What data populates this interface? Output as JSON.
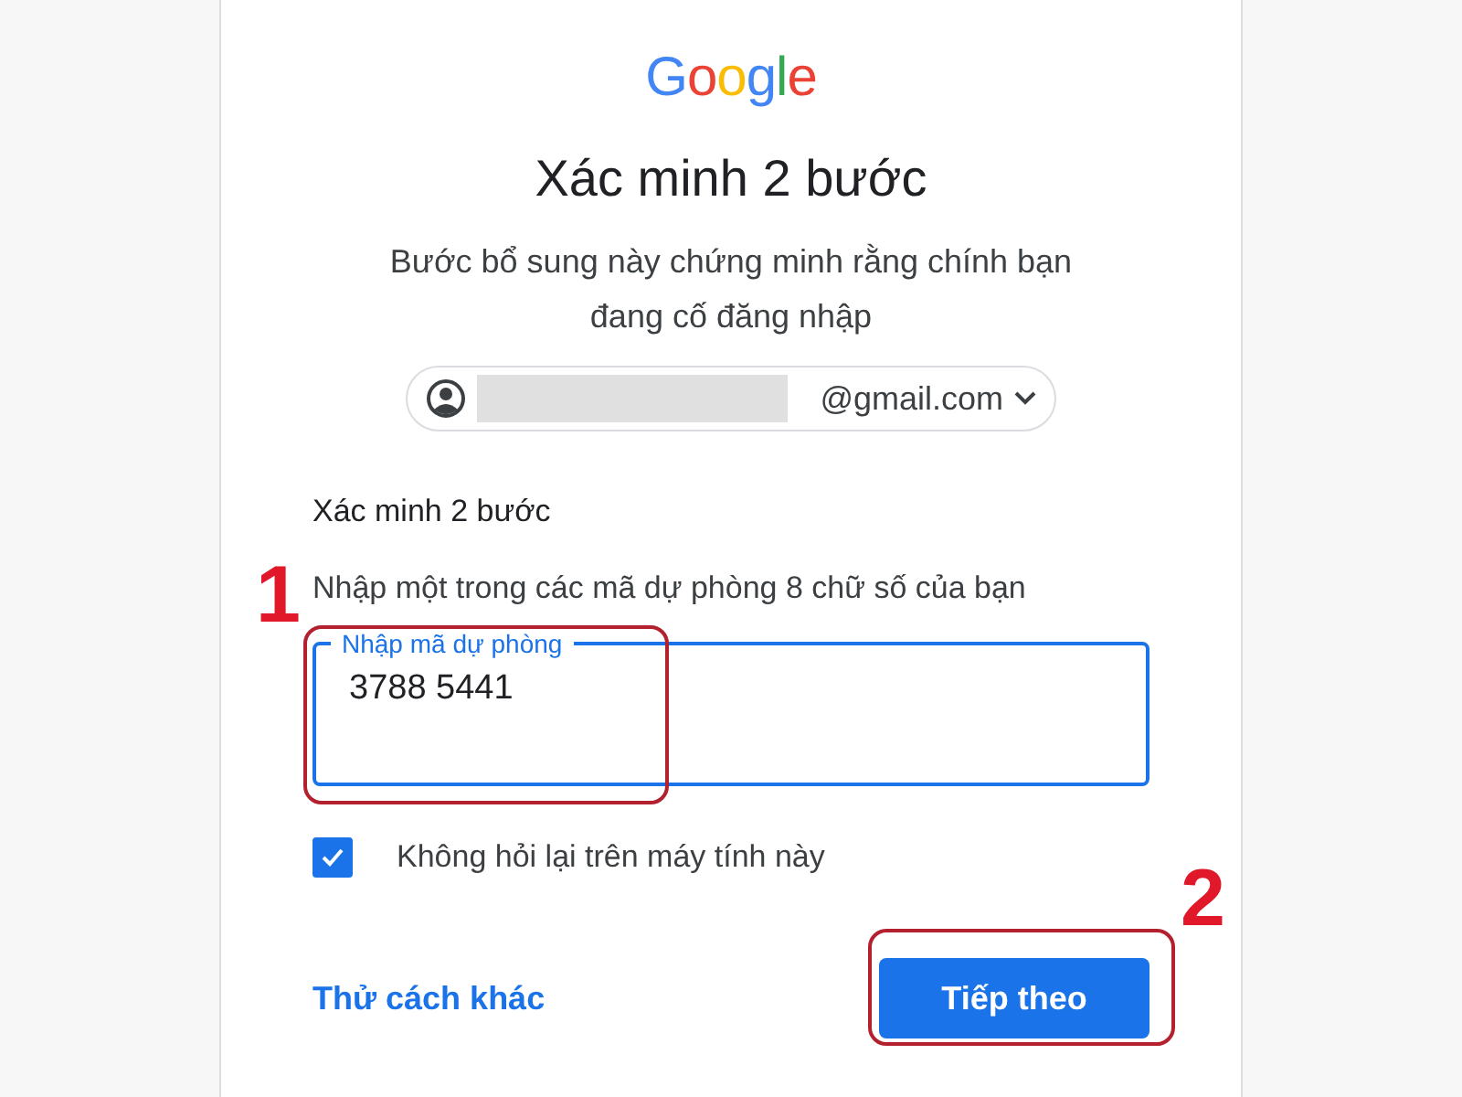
{
  "logo": "Google",
  "title": "Xác minh 2 bước",
  "subtitle": "Bước bổ sung này chứng minh rằng chính bạn đang cố đăng nhập",
  "account": {
    "email": "@gmail.com"
  },
  "section_title": "Xác minh 2 bước",
  "instruction": "Nhập một trong các mã dự phòng 8 chữ số của bạn",
  "code_field": {
    "label": "Nhập mã dự phòng",
    "value": "3788 5441",
    "focused": true
  },
  "remember": {
    "label": "Không hỏi lại trên máy tính này",
    "checked": true
  },
  "other_way_link": "Thử cách khác",
  "next_button": "Tiếp theo",
  "annotations": [
    "1",
    "2"
  ]
}
